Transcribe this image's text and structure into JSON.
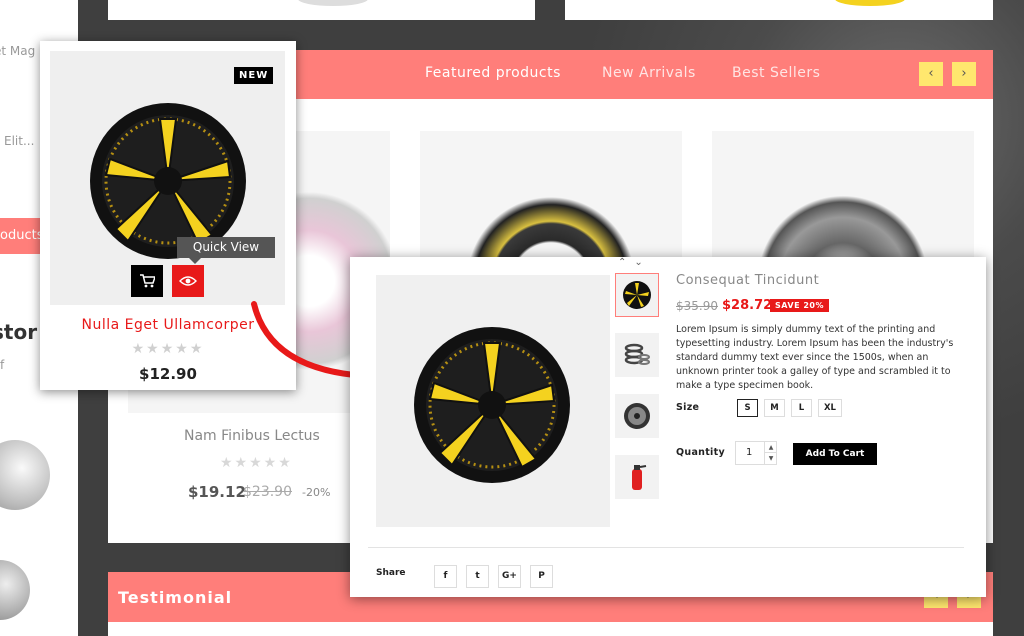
{
  "left_strip": {
    "snippet_1": "et Mag",
    "snippet_2": "Elit...",
    "pill_text": "oducts",
    "heading_fragment": "stor",
    "snippet_3": "f"
  },
  "featured": {
    "tabs": [
      {
        "label": "Featured products"
      },
      {
        "label": "New Arrivals"
      },
      {
        "label": "Best Sellers"
      }
    ],
    "prev_label": "‹",
    "next_label": "›",
    "card_name": "Nam Finibus Lectus",
    "card_stars": "★★★★★",
    "card_price": "$19.12",
    "card_old_price": "$23.90",
    "card_discount": "-20%"
  },
  "hover_card": {
    "badge": "NEW",
    "tooltip": "Quick View",
    "name": "Nulla Eget Ullamcorper",
    "stars": "★★★★★",
    "price": "$12.90"
  },
  "quick_view": {
    "thumb_nav": "⌃⌄",
    "title": "Consequat Tincidunt",
    "old_price": "$35.90",
    "new_price": "$28.72",
    "save_badge": "SAVE 20%",
    "description": "Lorem Ipsum is simply dummy text of the printing and typesetting industry. Lorem Ipsum has been the industry's standard dummy text ever since the 1500s, when an unknown printer took a galley of type and scrambled it to make a type specimen book.",
    "size_label": "Size",
    "sizes": [
      "S",
      "M",
      "L",
      "XL"
    ],
    "selected_size": "S",
    "quantity_label": "Quantity",
    "quantity": "1",
    "add_to_cart": "Add To Cart",
    "share_label": "Share",
    "share_buttons": [
      "f",
      "t",
      "G+",
      "P"
    ]
  },
  "testimonial": {
    "title": "Testimonial"
  },
  "colors": {
    "accent": "#ff7e7a",
    "sale_red": "#e81919",
    "nav_yellow": "#ffe76e",
    "wheel_yellow": "#f4d21f"
  }
}
